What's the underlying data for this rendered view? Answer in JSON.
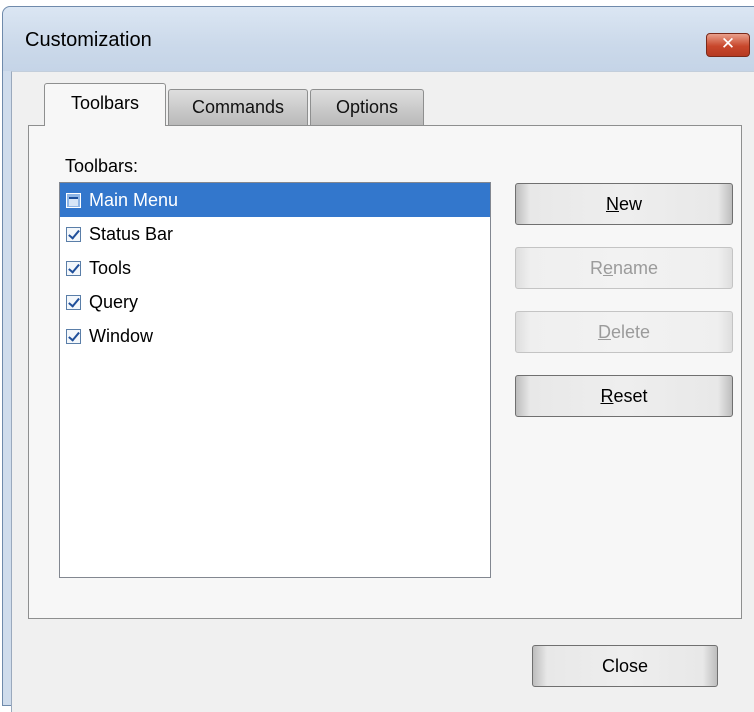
{
  "window": {
    "title": "Customization",
    "close_glyph": "✕"
  },
  "tabs": [
    {
      "label": "Toolbars",
      "active": true
    },
    {
      "label": "Commands",
      "active": false
    },
    {
      "label": "Options",
      "active": false
    }
  ],
  "toolbars_panel": {
    "list_label": "Toolbars:",
    "items": [
      {
        "label": "Main Menu",
        "checked": true,
        "selected": true
      },
      {
        "label": "Status Bar",
        "checked": true,
        "selected": false
      },
      {
        "label": "Tools",
        "checked": true,
        "selected": false
      },
      {
        "label": "Query",
        "checked": true,
        "selected": false
      },
      {
        "label": "Window",
        "checked": true,
        "selected": false
      }
    ],
    "buttons": {
      "new": {
        "mnemonic": "N",
        "rest": "ew",
        "enabled": true
      },
      "rename": {
        "pre": "R",
        "mnemonic": "e",
        "rest": "name",
        "enabled": false
      },
      "delete": {
        "mnemonic": "D",
        "rest": "elete",
        "enabled": false
      },
      "reset": {
        "mnemonic": "R",
        "rest": "eset",
        "enabled": true
      }
    }
  },
  "footer": {
    "close_label": "Close"
  },
  "colors": {
    "selection": "#3377cc",
    "frame": "#cfdcec",
    "close_button": "#c8472c"
  }
}
